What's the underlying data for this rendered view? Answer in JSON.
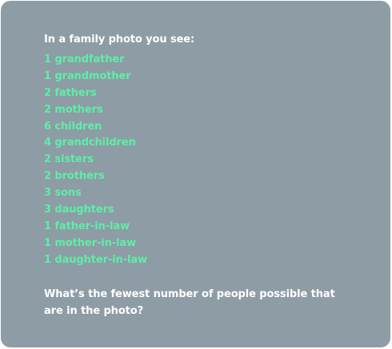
{
  "puzzle": {
    "intro": "In a family photo you see:",
    "items": [
      "1 grandfather",
      "1 grandmother",
      "2 fathers",
      "2 mothers",
      "6 children",
      "4 grandchildren",
      "2 sisters",
      "2 brothers",
      "3 sons",
      "3 daughters",
      "1 father-in-law",
      "1 mother-in-law",
      "1 daughter-in-law"
    ],
    "question": "What’s the fewest number of people possible that are in the photo?"
  },
  "colors": {
    "card_background": "#8e9ca6",
    "text": "#ffffff",
    "accent": "#5cf0a6"
  }
}
